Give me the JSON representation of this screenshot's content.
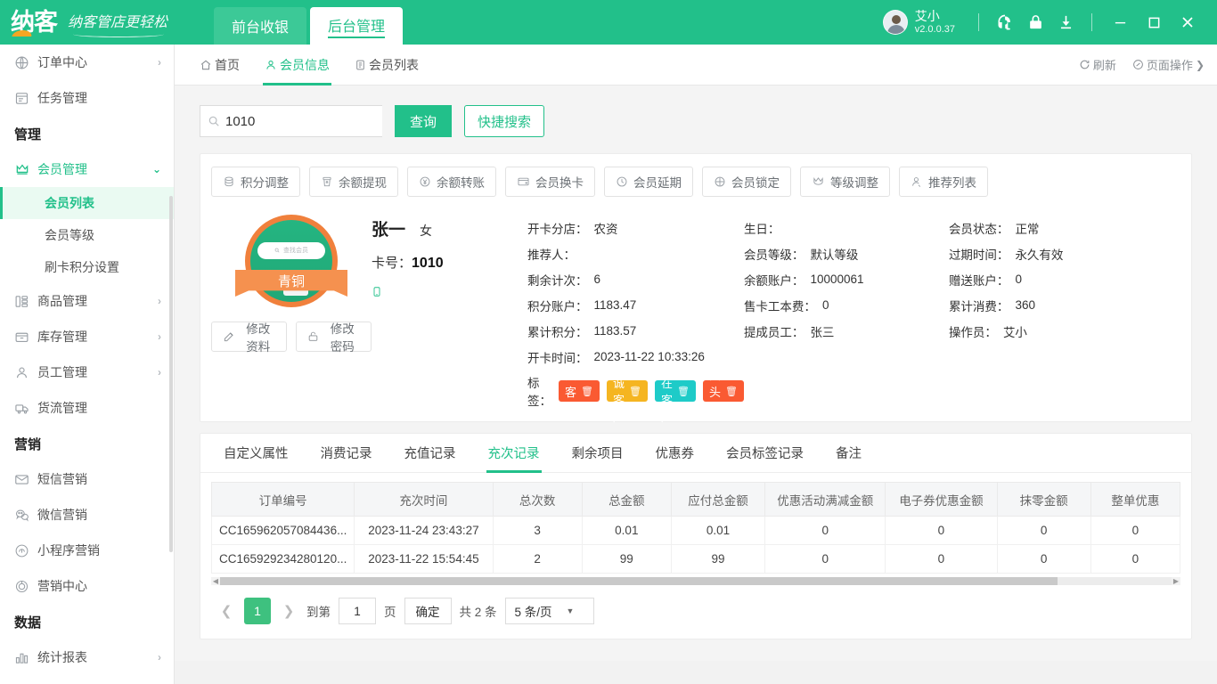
{
  "titlebar": {
    "logo_mark": "纳客",
    "logo_slogan": "纳客管店更轻松",
    "tabs": [
      {
        "label": "前台收银",
        "active": false
      },
      {
        "label": "后台管理",
        "active": true
      }
    ],
    "user_name": "艾小",
    "user_version": "v2.0.0.37",
    "icons": [
      "headset-icon",
      "lock-icon",
      "download-icon"
    ],
    "window_controls": {
      "minimize": "—",
      "maximize": "□",
      "close": "✕"
    },
    "brand_color": "#22c08a"
  },
  "sidebar": {
    "items": [
      {
        "type": "item",
        "label": "订单中心",
        "icon": "globe-icon",
        "chevron": "›"
      },
      {
        "type": "item",
        "label": "任务管理",
        "icon": "task-icon",
        "chevron": ""
      },
      {
        "type": "group",
        "label": "管理"
      },
      {
        "type": "item",
        "label": "会员管理",
        "icon": "crown-icon",
        "chevron": "⌄",
        "expanded": true
      },
      {
        "type": "sub",
        "label": "会员列表",
        "active": true
      },
      {
        "type": "sub",
        "label": "会员等级",
        "active": false
      },
      {
        "type": "sub",
        "label": "刷卡积分设置",
        "active": false
      },
      {
        "type": "item",
        "label": "商品管理",
        "icon": "goods-icon",
        "chevron": "›"
      },
      {
        "type": "item",
        "label": "库存管理",
        "icon": "inventory-icon",
        "chevron": "›"
      },
      {
        "type": "item",
        "label": "员工管理",
        "icon": "staff-icon",
        "chevron": "›"
      },
      {
        "type": "item",
        "label": "货流管理",
        "icon": "truck-icon",
        "chevron": ""
      },
      {
        "type": "group",
        "label": "营销"
      },
      {
        "type": "item",
        "label": "短信营销",
        "icon": "mail-icon",
        "chevron": ""
      },
      {
        "type": "item",
        "label": "微信营销",
        "icon": "wechat-icon",
        "chevron": ""
      },
      {
        "type": "item",
        "label": "小程序营销",
        "icon": "miniapp-icon",
        "chevron": ""
      },
      {
        "type": "item",
        "label": "营销中心",
        "icon": "target-icon",
        "chevron": ""
      },
      {
        "type": "group",
        "label": "数据"
      },
      {
        "type": "item",
        "label": "统计报表",
        "icon": "chart-icon",
        "chevron": "›"
      }
    ]
  },
  "page_tabs": {
    "tabs": [
      {
        "label": "首页",
        "icon": "home-icon",
        "active": false
      },
      {
        "label": "会员信息",
        "icon": "person-icon",
        "active": true
      },
      {
        "label": "会员列表",
        "icon": "list-icon",
        "active": false
      }
    ],
    "refresh_label": "刷新",
    "page_action_label": "页面操作",
    "page_action_chevron": "❯"
  },
  "search": {
    "value": "1010",
    "placeholder": "",
    "query_label": "查询",
    "quick_label": "快捷搜索"
  },
  "actions": [
    {
      "label": "积分调整",
      "icon": "coins-icon"
    },
    {
      "label": "余额提现",
      "icon": "withdraw-icon"
    },
    {
      "label": "余额转账",
      "icon": "yuan-transfer-icon"
    },
    {
      "label": "会员换卡",
      "icon": "card-icon"
    },
    {
      "label": "会员延期",
      "icon": "clock-icon"
    },
    {
      "label": "会员锁定",
      "icon": "lock-circle-icon"
    },
    {
      "label": "等级调整",
      "icon": "crown-icon"
    },
    {
      "label": "推荐列表",
      "icon": "user-plus-icon"
    }
  ],
  "member": {
    "medal_label": "青铜",
    "medal_search_text": "查找会员",
    "name": "张一",
    "sex": "女",
    "card_key": "卡号：",
    "card_no": "1010",
    "phone_icon": "mobile-icon",
    "edit_profile_label": "修改资料",
    "edit_password_label": "修改密码",
    "col1": [
      {
        "k": "开卡分店：",
        "v": "农资"
      },
      {
        "k": "推荐人：",
        "v": ""
      },
      {
        "k": "剩余计次：",
        "v": "6"
      },
      {
        "k": "积分账户：",
        "v": "1183.47"
      },
      {
        "k": "累计积分：",
        "v": "1183.57"
      },
      {
        "k": "开卡时间：",
        "v": "2023-11-22 10:33:26"
      }
    ],
    "col2": [
      {
        "k": "生日：",
        "v": ""
      },
      {
        "k": "会员等级：",
        "v": "默认等级"
      },
      {
        "k": "余额账户：",
        "v": "10000061"
      },
      {
        "k": "售卡工本费：",
        "v": "0"
      },
      {
        "k": "提成员工：",
        "v": "张三"
      }
    ],
    "col3": [
      {
        "k": "会员状态：",
        "v": "正常"
      },
      {
        "k": "过期时间：",
        "v": "永久有效"
      },
      {
        "k": "赠送账户：",
        "v": "0"
      },
      {
        "k": "累计消费：",
        "v": "360"
      },
      {
        "k": "操作员：",
        "v": "艾小"
      }
    ],
    "tags_label": "标签：",
    "tags": [
      {
        "label": "大客户",
        "color": "#fa5a32"
      },
      {
        "label": "忠诚客户",
        "color": "#f5b521"
      },
      {
        "label": "潜在客户",
        "color": "#1ecbc8"
      },
      {
        "label": "回头客",
        "color": "#fa5a32"
      }
    ]
  },
  "inner_tabs": [
    {
      "label": "自定义属性",
      "active": false
    },
    {
      "label": "消费记录",
      "active": false
    },
    {
      "label": "充值记录",
      "active": false
    },
    {
      "label": "充次记录",
      "active": true
    },
    {
      "label": "剩余项目",
      "active": false
    },
    {
      "label": "优惠券",
      "active": false
    },
    {
      "label": "会员标签记录",
      "active": false
    },
    {
      "label": "备注",
      "active": false
    }
  ],
  "table": {
    "columns": [
      "订单编号",
      "充次时间",
      "总次数",
      "总金额",
      "应付总金额",
      "优惠活动满减金额",
      "电子券优惠金额",
      "抹零金额",
      "整单优惠"
    ],
    "rows": [
      [
        "CC165962057084436...",
        "2023-11-24 23:43:27",
        "3",
        "0.01",
        "0.01",
        "0",
        "0",
        "0",
        "0"
      ],
      [
        "CC165929234280120...",
        "2023-11-22 15:54:45",
        "2",
        "99",
        "99",
        "0",
        "0",
        "0",
        "0"
      ]
    ]
  },
  "pager": {
    "prev": "❮",
    "next": "❯",
    "current_page": "1",
    "goto_label": "到第",
    "goto_value": "1",
    "page_unit": "页",
    "confirm_label": "确定",
    "total_label": "共 2 条",
    "page_size": "5 条/页",
    "caret": "▼"
  }
}
